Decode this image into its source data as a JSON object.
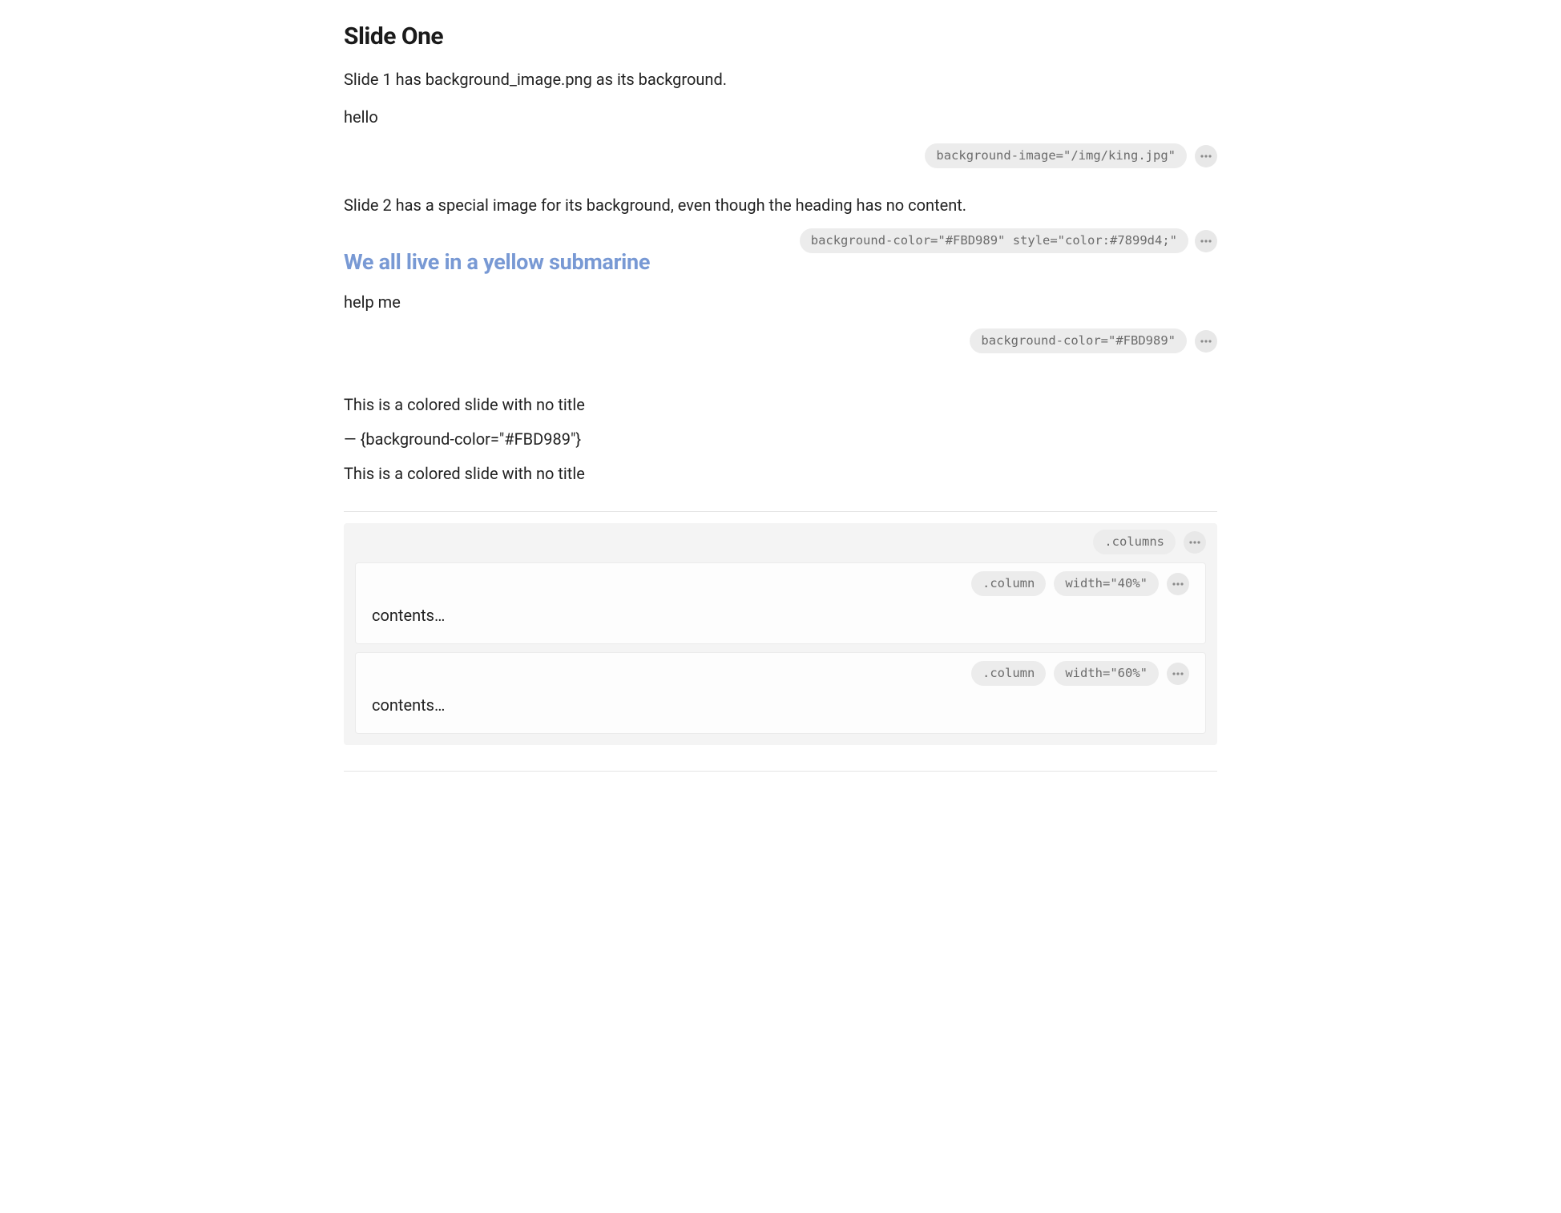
{
  "slide1": {
    "title": "Slide One",
    "line1": "Slide 1 has background_image.png as its background.",
    "line2": "hello",
    "attr": "background-image=\"/img/king.jpg\""
  },
  "slide2": {
    "line1": "Slide 2 has a special image for its background, even though the heading has no content.",
    "heading": "We all live in a yellow submarine",
    "heading_attr": "background-color=\"#FBD989\" style=\"color:#7899d4;\"",
    "line2": "help me",
    "attr2": "background-color=\"#FBD989\""
  },
  "slide3": {
    "line1": "This is a colored slide with no title",
    "line2": "— {background-color=\"#FBD989\"}",
    "line3": "This is a colored slide with no title"
  },
  "columns": {
    "tag_outer": ".columns",
    "col1": {
      "tag": ".column",
      "width": "width=\"40%\"",
      "content": "contents…"
    },
    "col2": {
      "tag": ".column",
      "width": "width=\"60%\"",
      "content": "contents…"
    }
  },
  "colors": {
    "accent": "#7899d4",
    "pill_bg": "#ececec",
    "pill_fg": "#6c6c6c",
    "block_bg": "#f4f4f4"
  }
}
